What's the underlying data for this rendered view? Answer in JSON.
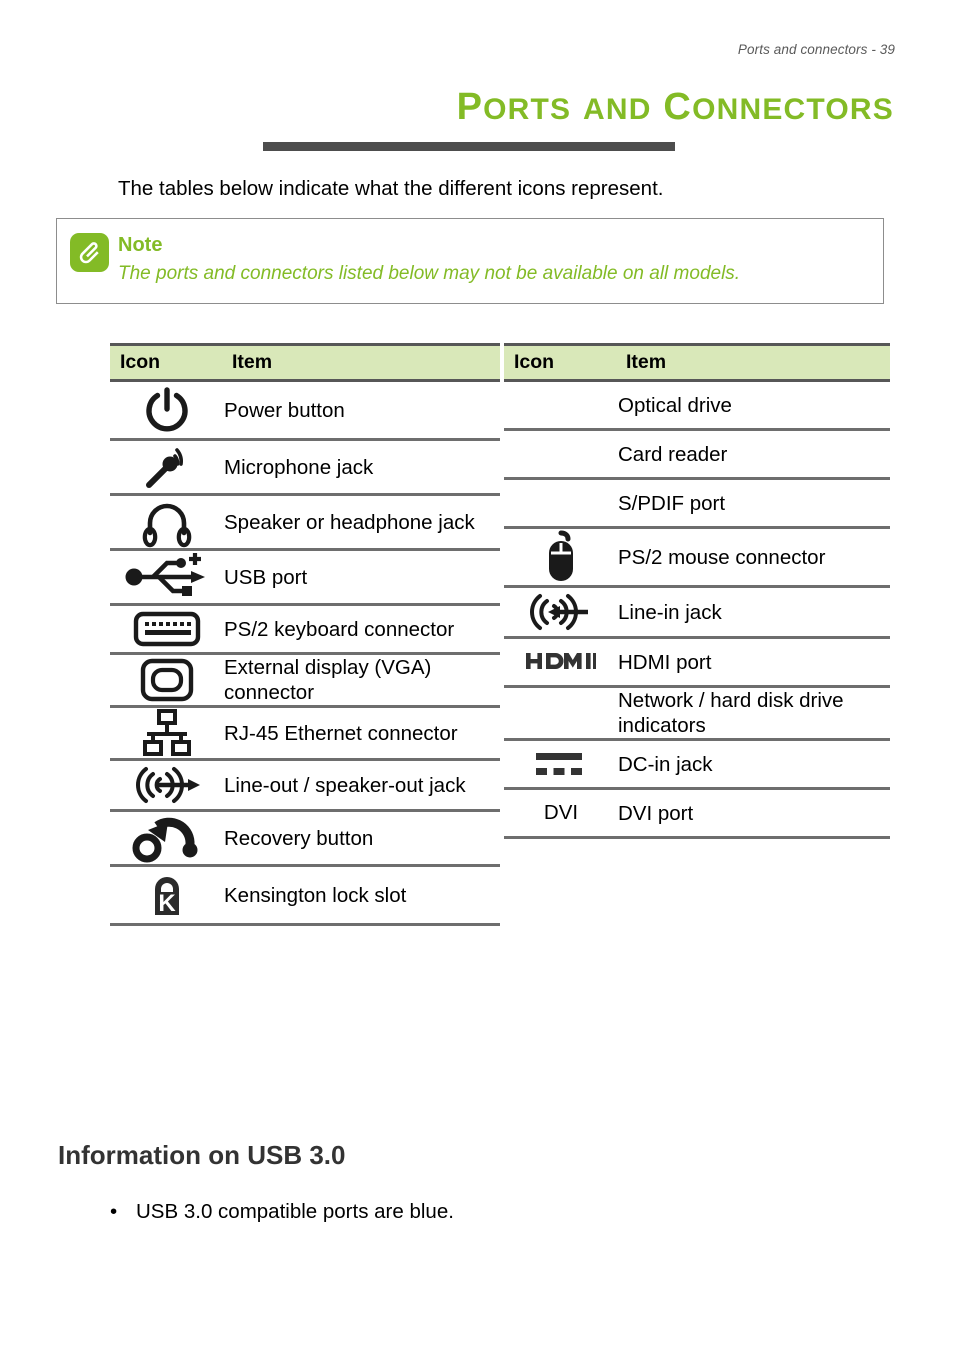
{
  "header": {
    "running_head": "Ports and connectors - 39"
  },
  "title": {
    "word1_cap": "P",
    "word1_rest": "ORTS",
    "word2": "AND",
    "word3_cap": "C",
    "word3_rest": "ONNECTORS",
    "full": "Ports and connectors",
    "color": "#83bb26"
  },
  "intro": "The tables below indicate what the different icons represent.",
  "note": {
    "icon": "paperclip-icon",
    "title": "Note",
    "text": "The ports and connectors listed below may not be available on all models.",
    "color": "#83bb26"
  },
  "tables": {
    "header_bg": "#d9e8b9",
    "columns": [
      "Icon",
      "Item"
    ],
    "left": {
      "headers": {
        "icon": "Icon",
        "item": "Item"
      },
      "rows": [
        {
          "icon": "power-button-icon",
          "item": "Power button"
        },
        {
          "icon": "microphone-icon",
          "item": "Microphone jack"
        },
        {
          "icon": "headphone-icon",
          "item": "Speaker or headphone jack"
        },
        {
          "icon": "usb-icon",
          "item": "USB port"
        },
        {
          "icon": "keyboard-icon",
          "item": "PS/2 keyboard connector"
        },
        {
          "icon": "vga-display-icon",
          "item": "External display (VGA) connector"
        },
        {
          "icon": "ethernet-icon",
          "item": "RJ-45 Ethernet connector"
        },
        {
          "icon": "line-out-icon",
          "item": "Line-out / speaker-out jack"
        },
        {
          "icon": "recovery-icon",
          "item": "Recovery button"
        },
        {
          "icon": "kensington-lock-icon",
          "item": "Kensington lock slot"
        }
      ]
    },
    "right": {
      "headers": {
        "icon": "Icon",
        "item": "Item"
      },
      "rows": [
        {
          "icon": "",
          "item": "Optical drive"
        },
        {
          "icon": "",
          "item": "Card reader"
        },
        {
          "icon": "",
          "item": "S/PDIF port"
        },
        {
          "icon": "mouse-icon",
          "item": "PS/2 mouse connector"
        },
        {
          "icon": "line-in-icon",
          "item": "Line-in jack"
        },
        {
          "icon": "hdmi-logo-icon",
          "item": "HDMI port",
          "icon_text": "HDMI"
        },
        {
          "icon": "",
          "item": "Network / hard disk drive indicators"
        },
        {
          "icon": "dc-in-icon",
          "item": "DC-in jack"
        },
        {
          "icon": "dvi-text-icon",
          "item": "DVI port",
          "icon_text": "DVI"
        }
      ]
    }
  },
  "section": {
    "heading": "Information on USB 3.0",
    "bullets": [
      {
        "marker": "•",
        "text": "USB 3.0 compatible ports are blue."
      }
    ]
  }
}
